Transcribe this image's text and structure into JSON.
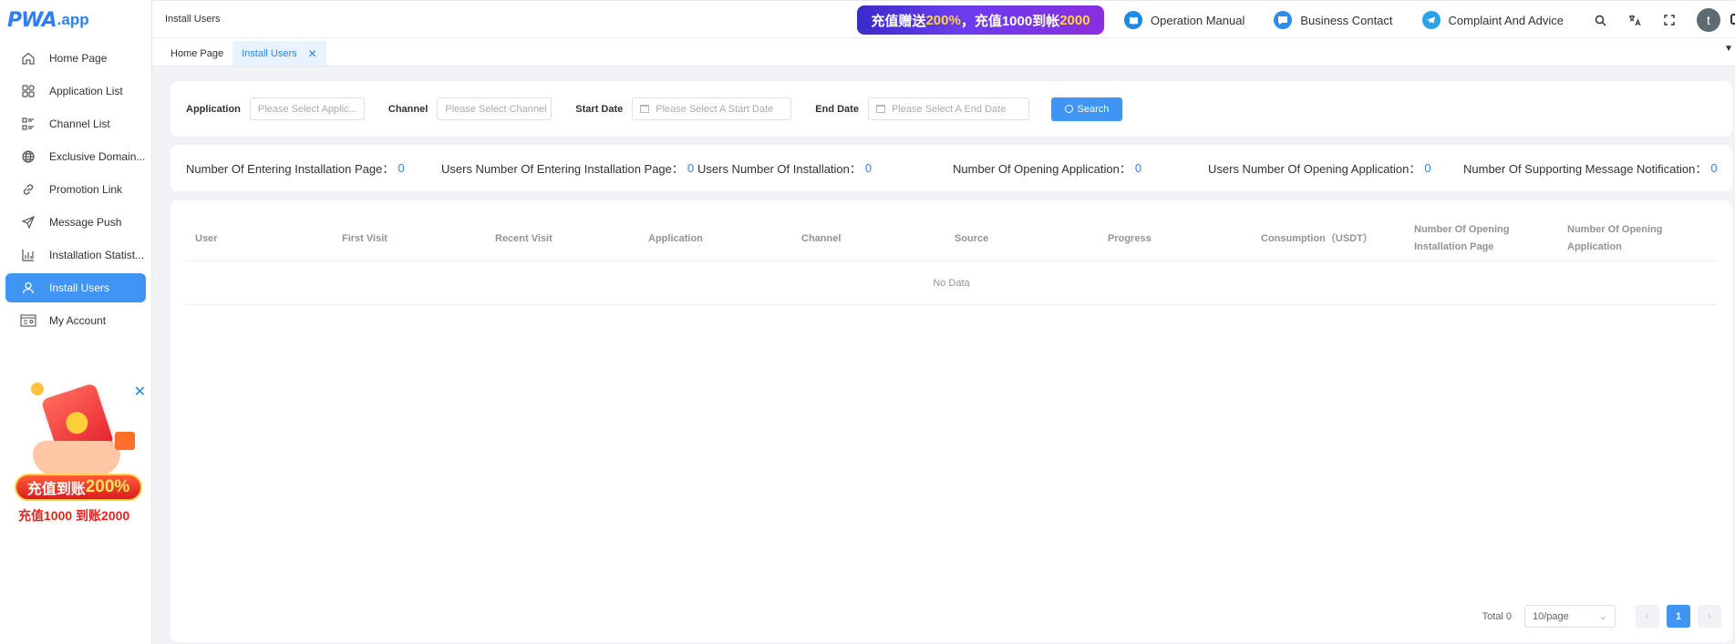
{
  "brand": {
    "logo_text": "PWA",
    "logo_suffix": ".app"
  },
  "sidebar": {
    "items": [
      {
        "label": "Home Page",
        "icon": "home-icon",
        "active": false
      },
      {
        "label": "Application List",
        "icon": "apps-grid-icon",
        "active": false
      },
      {
        "label": "Channel List",
        "icon": "channel-list-icon",
        "active": false
      },
      {
        "label": "Exclusive Domain...",
        "icon": "globe-icon",
        "active": false
      },
      {
        "label": "Promotion Link",
        "icon": "link-icon",
        "active": false
      },
      {
        "label": "Message Push",
        "icon": "send-icon",
        "active": false
      },
      {
        "label": "Installation Statist...",
        "icon": "bar-chart-icon",
        "active": false
      },
      {
        "label": "Install Users",
        "icon": "user-icon",
        "active": true
      },
      {
        "label": "My Account",
        "icon": "account-card-icon",
        "active": false
      }
    ]
  },
  "promo": {
    "badge_prefix": "充值到账",
    "badge_value": "200%",
    "sub_text": "充值1000 到账2000"
  },
  "header": {
    "breadcrumb": "Install Users",
    "banner_prefix": "充值赠送",
    "banner_value": "200%",
    "banner_mid": "，充值1000到帐",
    "banner_value2": "2000",
    "links": [
      {
        "label": "Operation Manual",
        "icon": "book-icon"
      },
      {
        "label": "Business Contact",
        "icon": "chat-icon"
      },
      {
        "label": "Complaint And Advice",
        "icon": "telegram-icon"
      }
    ],
    "avatar_letter": "t"
  },
  "tabs": [
    {
      "label": "Home Page",
      "active": false
    },
    {
      "label": "Install Users",
      "active": true
    }
  ],
  "filters": {
    "application_label": "Application",
    "application_placeholder": "Please Select Applic...",
    "channel_label": "Channel",
    "channel_placeholder": "Please Select Channel",
    "start_label": "Start Date",
    "start_placeholder": "Please Select A Start Date",
    "end_label": "End Date",
    "end_placeholder": "Please Select A End Date",
    "search_label": "Search"
  },
  "stats": [
    {
      "label": "Number Of Entering Installation Page：",
      "value": "0"
    },
    {
      "label": "Users Number Of Entering Installation Page：",
      "value": "0"
    },
    {
      "label": "Users Number Of Installation：",
      "value": "0"
    },
    {
      "label": "Number Of Opening Application：",
      "value": "0"
    },
    {
      "label": "Users Number Of Opening Application：",
      "value": "0"
    },
    {
      "label": "Number Of Supporting Message Notification：",
      "value": "0"
    }
  ],
  "table": {
    "columns": [
      "User",
      "First Visit",
      "Recent Visit",
      "Application",
      "Channel",
      "Source",
      "Progress",
      "Consumption（USDT）",
      "Number Of Opening Installation Page",
      "Number Of Opening Application"
    ],
    "empty_text": "No Data"
  },
  "pagination": {
    "total_text": "Total 0",
    "page_size": "10/page",
    "current_page": "1"
  },
  "colors": {
    "accent": "#3f94f4",
    "link": "#2b85f0",
    "banner": "#6a3cf0"
  }
}
